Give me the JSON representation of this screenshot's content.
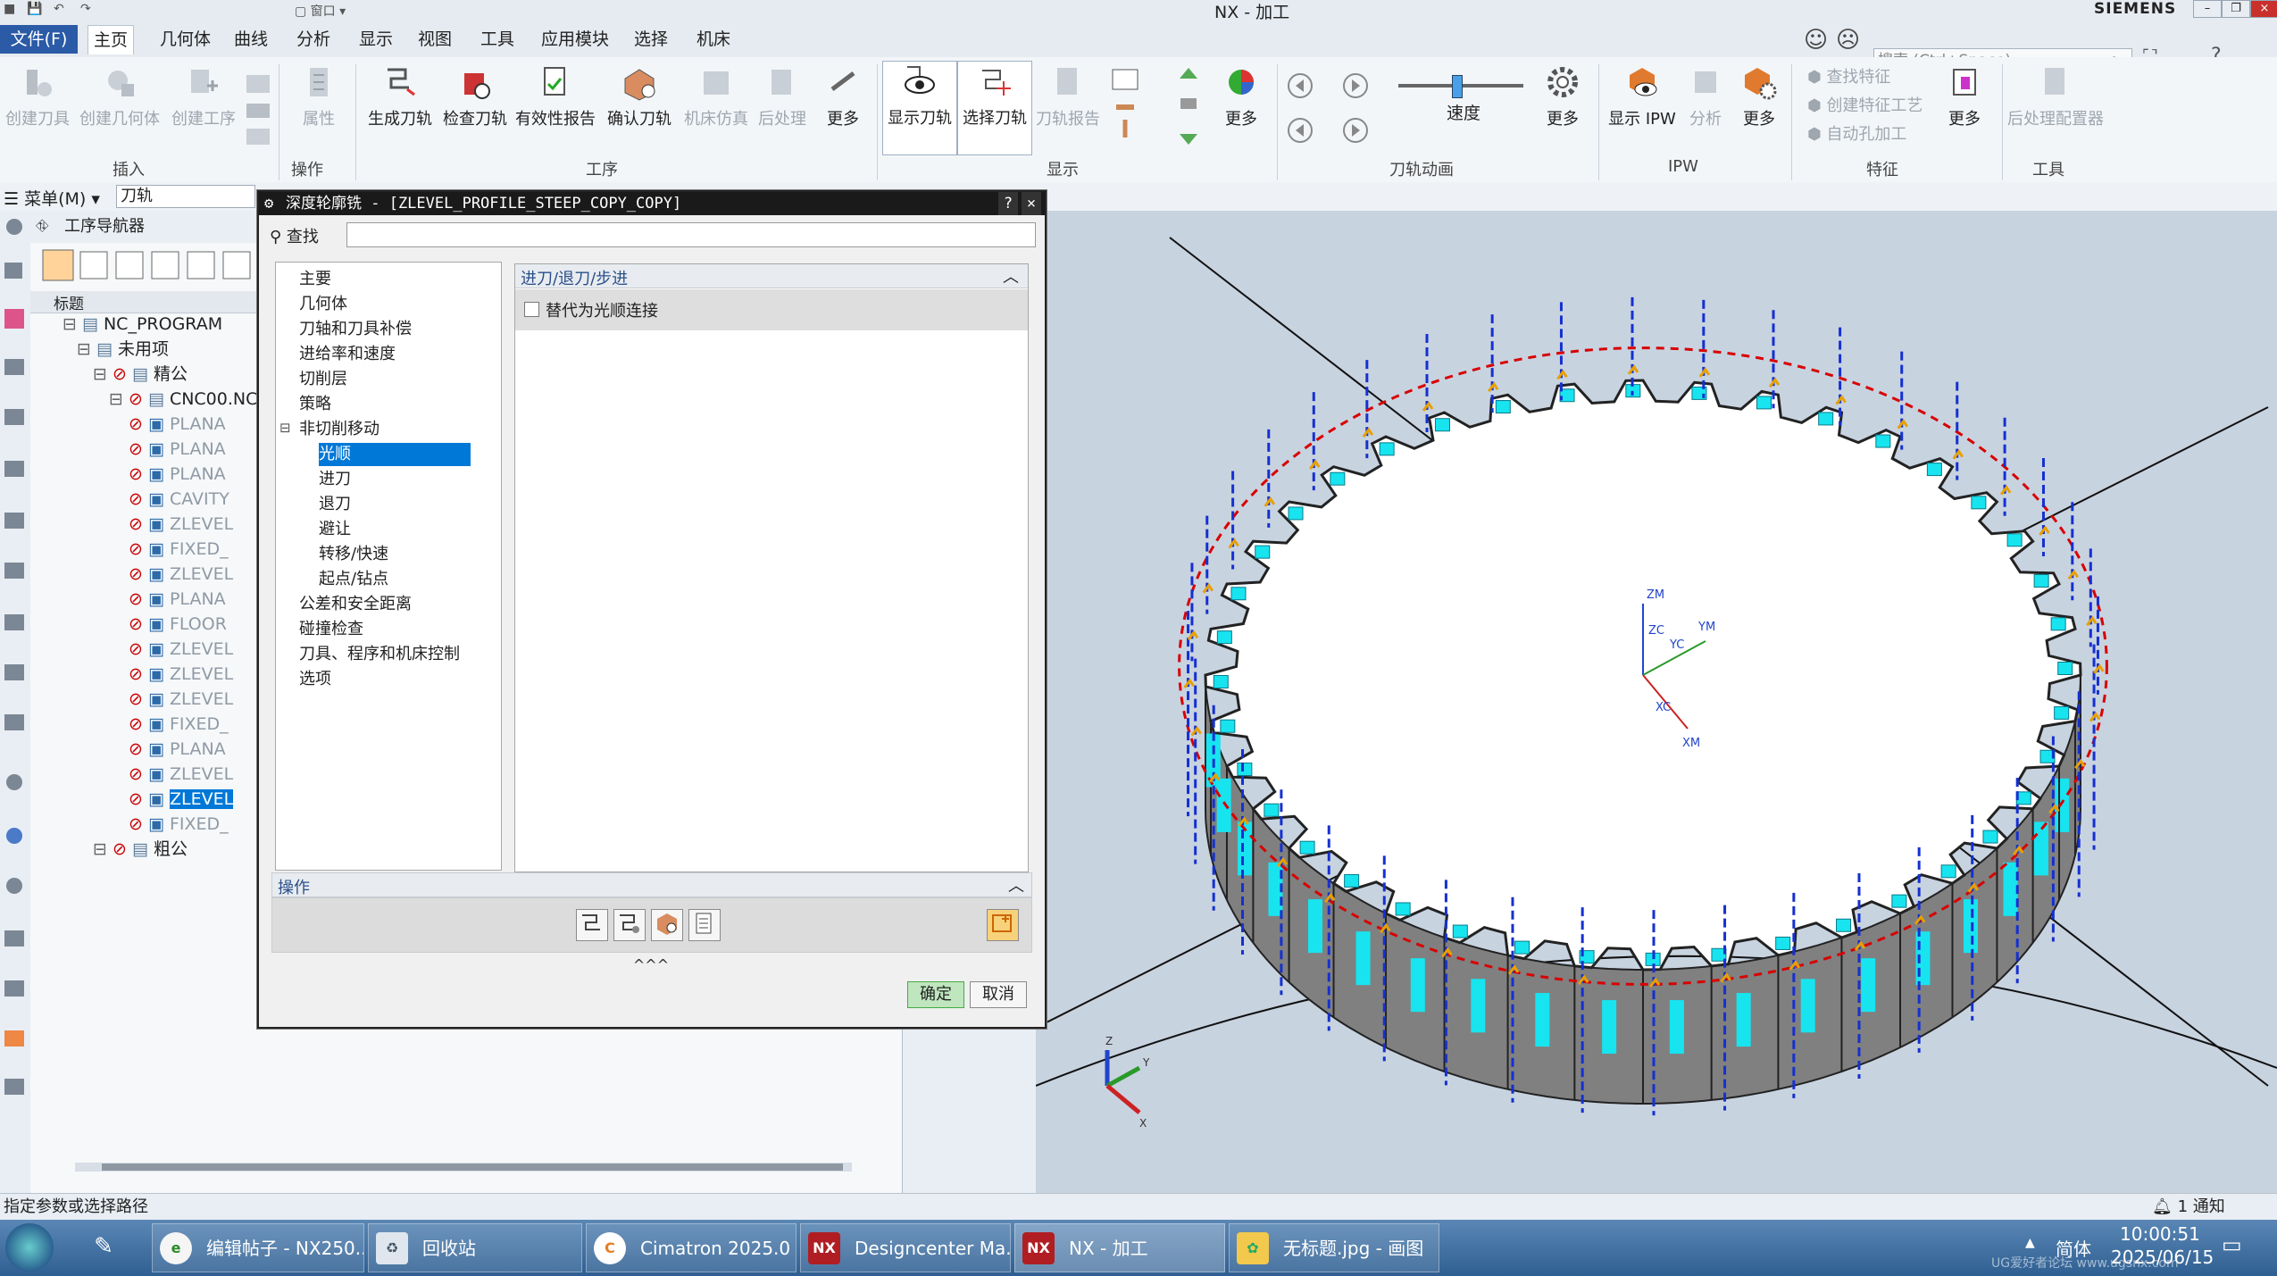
{
  "window": {
    "title": "NX - 加工",
    "brand": "SIEMENS"
  },
  "tabs": [
    "文件(F)",
    "主页",
    "几何体",
    "曲线",
    "分析",
    "显示",
    "视图",
    "工具",
    "应用模块",
    "选择",
    "机床"
  ],
  "search": {
    "placeholder": "搜索 (Ctrl+Space)"
  },
  "ribbon": {
    "insert": {
      "label": "插入",
      "buttons": [
        "创建刀具",
        "创建几何体",
        "创建工序"
      ]
    },
    "operation": {
      "label": "操作",
      "buttons": [
        "属性"
      ]
    },
    "process": {
      "label": "工序",
      "buttons": [
        "生成刀轨",
        "检查刀轨",
        "有效性报告",
        "确认刀轨",
        "机床仿真",
        "后处理",
        "更多"
      ]
    },
    "display": {
      "label": "显示",
      "buttons": [
        "显示刀轨",
        "选择刀轨",
        "刀轨报告",
        "更多"
      ]
    },
    "animation": {
      "label": "刀轨动画",
      "speed": "速度",
      "more": "更多"
    },
    "ipw": {
      "label": "IPW",
      "buttons": [
        "显示 IPW",
        "分析",
        "更多"
      ]
    },
    "feature": {
      "label": "特征",
      "items": [
        "查找特征",
        "创建特征工艺",
        "自动孔加工"
      ],
      "more": "更多"
    },
    "tools": {
      "label": "工具",
      "buttons": [
        "后处理配置器"
      ]
    }
  },
  "selbar": {
    "menu": "菜单(M)",
    "filter": "刀轨"
  },
  "navigator": {
    "title": "工序导航器",
    "column": "标题",
    "rows": [
      {
        "text": "NC_PROGRAM",
        "level": 0
      },
      {
        "text": "未用项",
        "level": 1
      },
      {
        "text": "精公",
        "level": 2
      },
      {
        "text": "CNC00.NC",
        "level": 3
      },
      {
        "text": "PLANA",
        "level": 4
      },
      {
        "text": "PLANA",
        "level": 4
      },
      {
        "text": "PLANA",
        "level": 4
      },
      {
        "text": "CAVITY",
        "level": 4
      },
      {
        "text": "ZLEVEL",
        "level": 4
      },
      {
        "text": "FIXED_",
        "level": 4
      },
      {
        "text": "ZLEVEL",
        "level": 4
      },
      {
        "text": "PLANA",
        "level": 4
      },
      {
        "text": "FLOOR",
        "level": 4
      },
      {
        "text": "ZLEVEL",
        "level": 4
      },
      {
        "text": "ZLEVEL",
        "level": 4
      },
      {
        "text": "ZLEVEL",
        "level": 4
      },
      {
        "text": "FIXED_",
        "level": 4
      },
      {
        "text": "PLANA",
        "level": 4
      },
      {
        "text": "ZLEVEL",
        "level": 4
      },
      {
        "text": "ZLEVEL",
        "level": 4,
        "selected": true
      },
      {
        "text": "FIXED_",
        "level": 4
      },
      {
        "text": "粗公",
        "level": 2
      }
    ]
  },
  "dialog": {
    "title": "深度轮廓铣 - [ZLEVEL_PROFILE_STEEP_COPY_COPY]",
    "find_label": "查找",
    "find_value": "",
    "categories": [
      {
        "text": "主要",
        "indent": 0
      },
      {
        "text": "几何体",
        "indent": 0
      },
      {
        "text": "刀轴和刀具补偿",
        "indent": 0
      },
      {
        "text": "进给率和速度",
        "indent": 0
      },
      {
        "text": "切削层",
        "indent": 0
      },
      {
        "text": "策略",
        "indent": 0
      },
      {
        "text": "非切削移动",
        "indent": 0,
        "expander": true
      },
      {
        "text": "光顺",
        "indent": 1,
        "selected": true
      },
      {
        "text": "进刀",
        "indent": 1
      },
      {
        "text": "退刀",
        "indent": 1
      },
      {
        "text": "避让",
        "indent": 1
      },
      {
        "text": "转移/快速",
        "indent": 1
      },
      {
        "text": "起点/钻点",
        "indent": 1
      },
      {
        "text": "公差和安全距离",
        "indent": 0
      },
      {
        "text": "碰撞检查",
        "indent": 0
      },
      {
        "text": "刀具、程序和机床控制",
        "indent": 0
      },
      {
        "text": "选项",
        "indent": 0
      }
    ],
    "panel_header": "进刀/退刀/步进",
    "option": {
      "label": "替代为光顺连接",
      "checked": false
    },
    "actions_label": "操作",
    "ok": "确定",
    "cancel": "取消",
    "help": "?",
    "close": "×"
  },
  "viewport": {
    "wcs_labels": [
      "ZM",
      "ZC",
      "YM",
      "YC",
      "XC",
      "XM"
    ],
    "triad_labels": [
      "Z",
      "Y",
      "X"
    ]
  },
  "status": {
    "message": "指定参数或选择路径",
    "notice": "1 通知"
  },
  "taskbar": {
    "items": [
      "编辑帖子 - NX250...",
      "回收站",
      "Cimatron 2025.0 ...",
      "Designcenter Ma...",
      "NX - 加工",
      "无标题.jpg - 画图"
    ],
    "lang": "简体",
    "time": "10:00:51",
    "date": "2025/06/15",
    "watermark": "UG爱好者论坛 www.ugsnx.com"
  },
  "colors": {
    "accent": "#2b5aa6",
    "selection": "#0078d7",
    "toolpath_blue": "#1530d0",
    "cut_cyan": "#18e4f0",
    "boundary_red": "#d80000"
  }
}
